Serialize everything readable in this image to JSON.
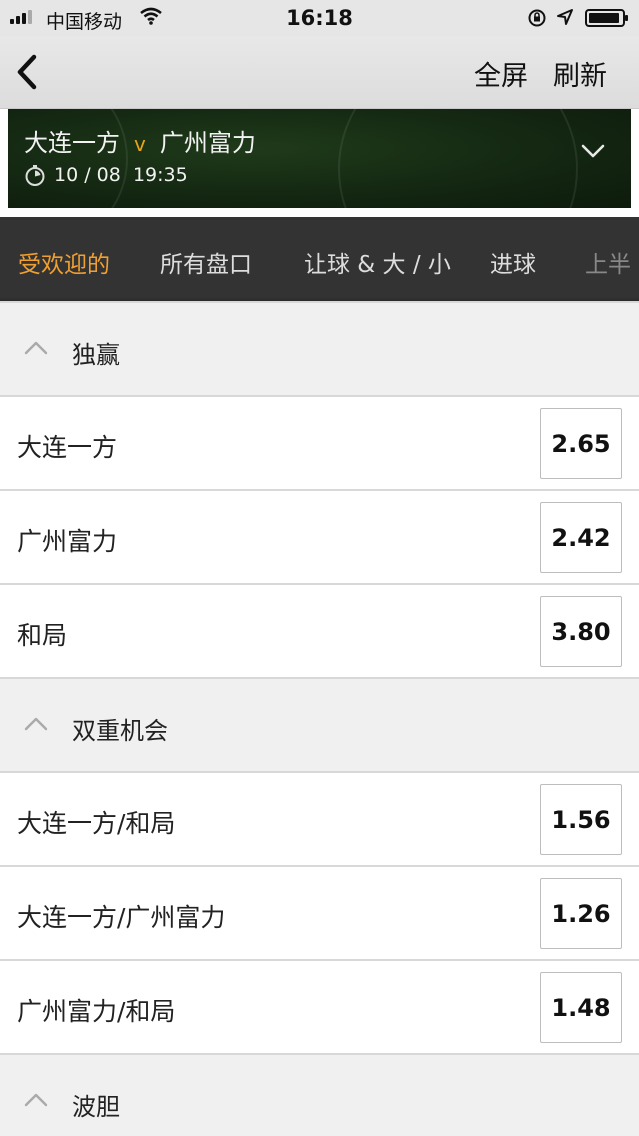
{
  "status_bar": {
    "carrier": "中国移动",
    "time": "16:18"
  },
  "nav": {
    "fullscreen_label": "全屏",
    "refresh_label": "刷新"
  },
  "match": {
    "home": "大连一方",
    "vs": "v",
    "away": "广州富力",
    "date": "10 / 08",
    "time": "19:35"
  },
  "tabs": [
    {
      "label": "受欢迎的",
      "active": true
    },
    {
      "label": "所有盘口"
    },
    {
      "label": "让球 & 大 / 小"
    },
    {
      "label": "进球"
    },
    {
      "label": "上半"
    }
  ],
  "sections": [
    {
      "title": "独赢",
      "rows": [
        {
          "name": "大连一方",
          "odds": "2.65"
        },
        {
          "name": "广州富力",
          "odds": "2.42"
        },
        {
          "name": "和局",
          "odds": "3.80"
        }
      ]
    },
    {
      "title": "双重机会",
      "rows": [
        {
          "name": "大连一方/和局",
          "odds": "1.56"
        },
        {
          "name": "大连一方/广州富力",
          "odds": "1.26"
        },
        {
          "name": "广州富力/和局",
          "odds": "1.48"
        }
      ]
    },
    {
      "title": "波胆",
      "rows": []
    }
  ],
  "colors": {
    "accent": "#f0a030",
    "tab_bar": "#333333",
    "vs": "#e8a317"
  }
}
